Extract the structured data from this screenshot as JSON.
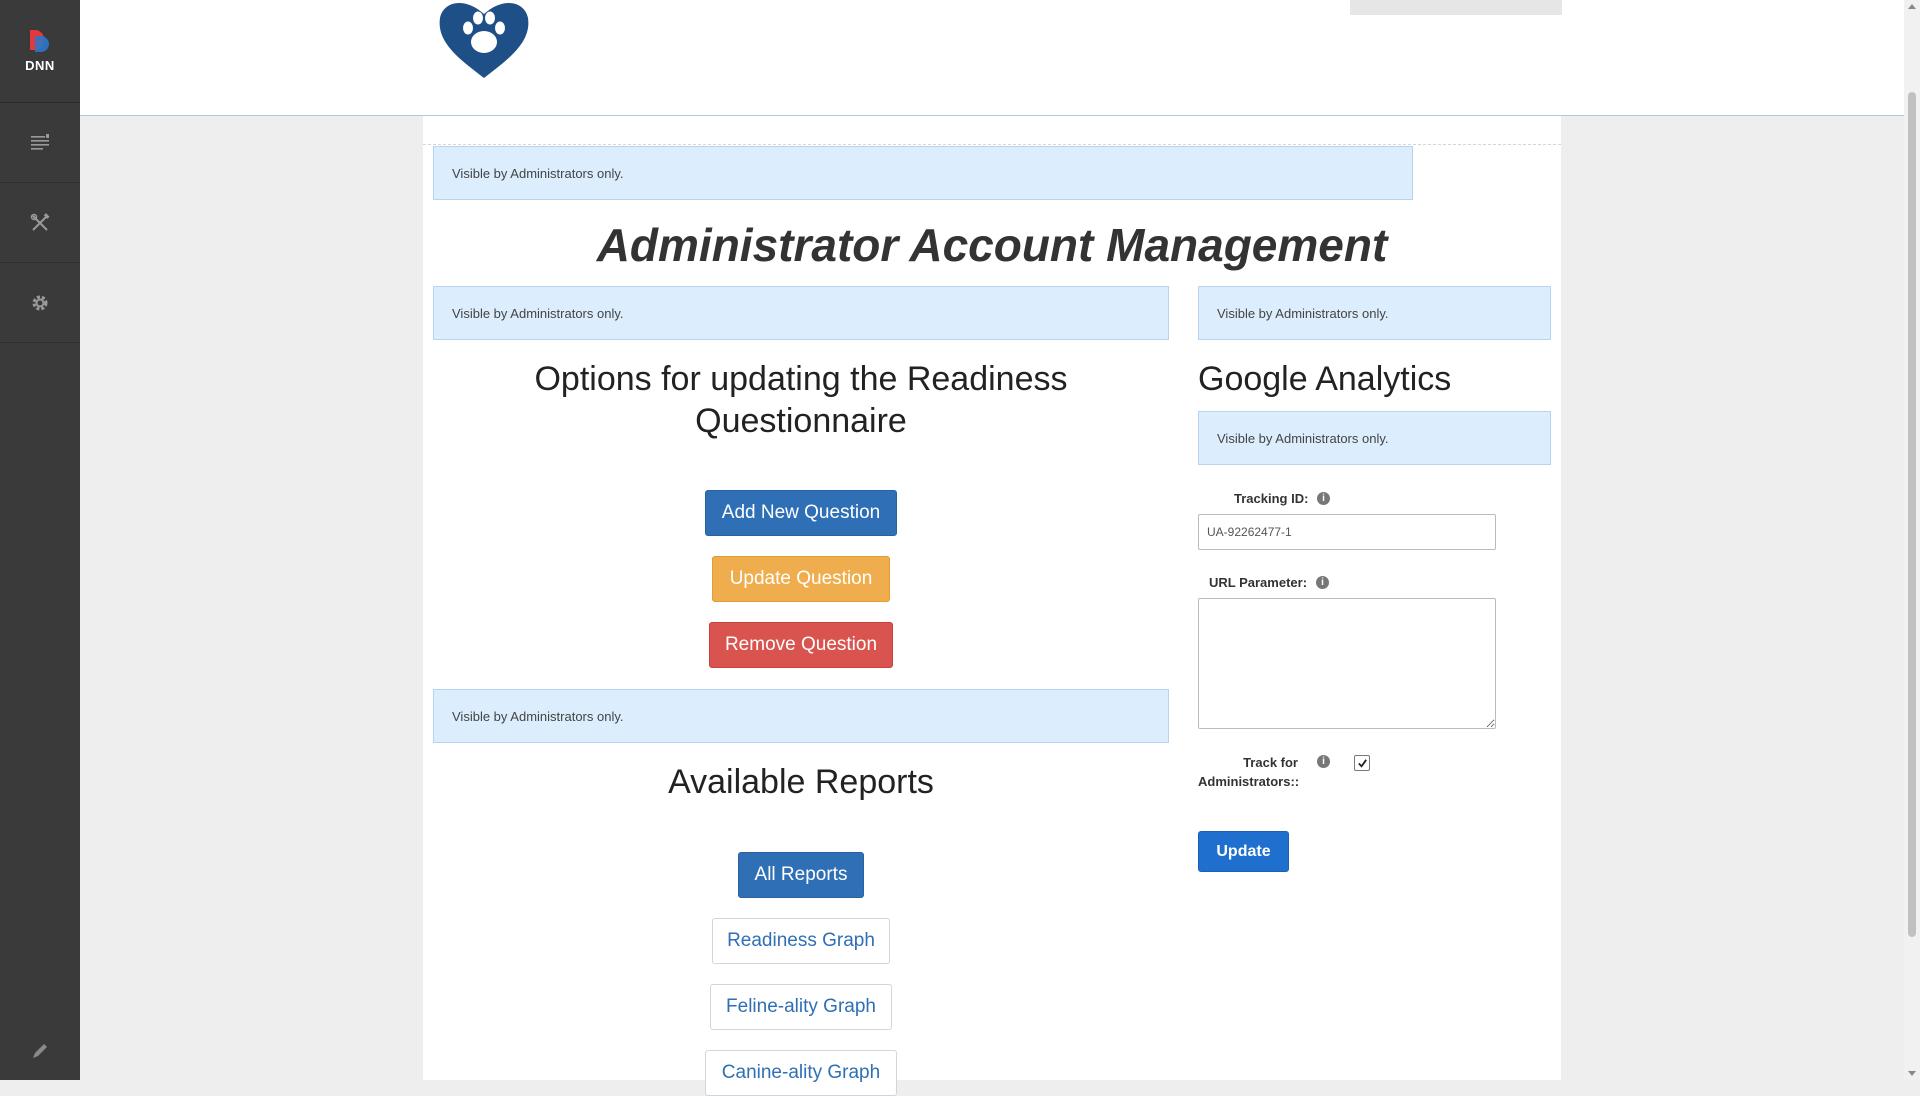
{
  "persona_bar": {
    "logo_text": "DNN",
    "items": [
      {
        "icon": "content-icon"
      },
      {
        "icon": "manage-icon"
      },
      {
        "icon": "settings-icon"
      }
    ],
    "edit_icon": "pencil-icon"
  },
  "notices": {
    "text": "Visible by Administrators only."
  },
  "page": {
    "title": "Administrator Account Management"
  },
  "questionnaire": {
    "heading": "Options for updating the Readiness Questionnaire",
    "buttons": {
      "add": "Add New Question",
      "update": "Update Question",
      "remove": "Remove Question"
    }
  },
  "reports": {
    "heading": "Available Reports",
    "buttons": {
      "all": "All Reports",
      "readiness": "Readiness Graph",
      "feline": "Feline-ality Graph",
      "canine": "Canine-ality Graph"
    }
  },
  "analytics": {
    "heading": "Google Analytics",
    "tracking_label": "Tracking ID:",
    "tracking_value": "UA-92262477-1",
    "url_label": "URL Parameter:",
    "url_value": "",
    "track_admin_label_1": "Track for",
    "track_admin_label_2": "Administrators::",
    "track_admin_checked": true,
    "update_label": "Update"
  },
  "colors": {
    "primary": "#2f6fb5",
    "warning": "#f0ad4e",
    "danger": "#d9534f",
    "notice_bg": "#dcedfd",
    "brand": "#1e4f86"
  }
}
